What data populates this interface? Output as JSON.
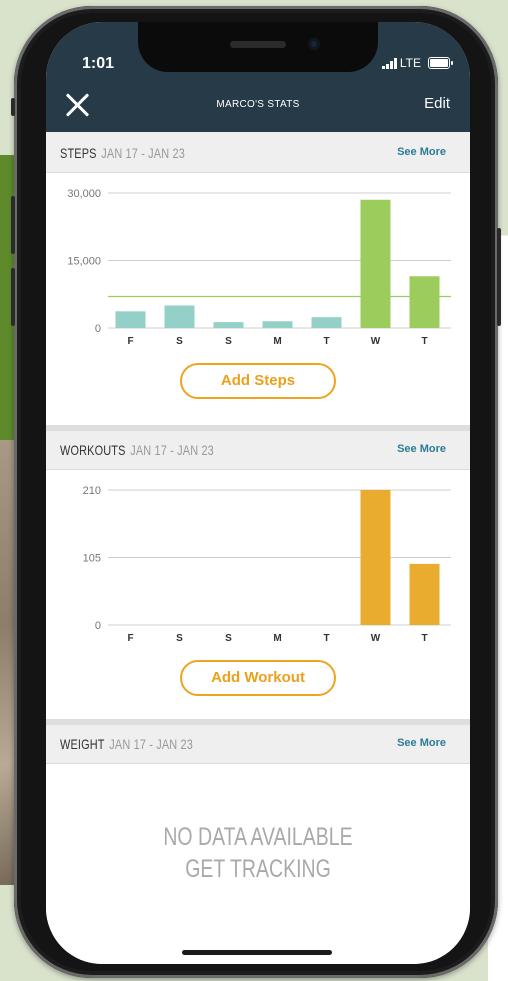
{
  "status_bar": {
    "time": "1:01",
    "network": "LTE"
  },
  "header": {
    "title": "MARCO'S STATS",
    "edit_label": "Edit"
  },
  "steps_section": {
    "title": "STEPS",
    "range": "JAN 17 - JAN 23",
    "see_more": "See More",
    "add_button": "Add Steps"
  },
  "workouts_section": {
    "title": "WORKOUTS",
    "range": "JAN 17 - JAN 23",
    "see_more": "See More",
    "add_button": "Add Workout"
  },
  "weight_section": {
    "title": "WEIGHT",
    "range": "JAN 17 - JAN 23",
    "see_more": "See More",
    "empty_line1": "NO DATA AVAILABLE",
    "empty_line2": "GET TRACKING"
  },
  "colors": {
    "header": "#263a47",
    "steps_past": "#92d0c8",
    "steps_recent": "#9ccd5c",
    "goal_line": "#9ccd5c",
    "workouts": "#eaac2e",
    "accent": "#f0a321"
  },
  "chart_data": [
    {
      "type": "bar",
      "categories": [
        "F",
        "S",
        "S",
        "M",
        "T",
        "W",
        "T"
      ],
      "values": [
        3700,
        5000,
        1300,
        1500,
        2400,
        28500,
        11500
      ],
      "ylim": [
        0,
        30000
      ],
      "y_ticks": [
        "0",
        "15,000",
        "30,000"
      ],
      "goal": 7000
    },
    {
      "type": "bar",
      "categories": [
        "F",
        "S",
        "S",
        "M",
        "T",
        "W",
        "T"
      ],
      "values": [
        0,
        0,
        0,
        0,
        0,
        210,
        95
      ],
      "ylim": [
        0,
        210
      ],
      "y_ticks": [
        "0",
        "105",
        "210"
      ]
    }
  ]
}
